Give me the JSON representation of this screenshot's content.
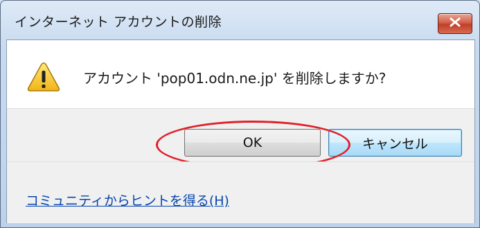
{
  "window": {
    "title": "インターネット アカウントの削除",
    "close_icon": "close-x-icon"
  },
  "dialog": {
    "icon": "warning-icon",
    "message": "アカウント 'pop01.odn.ne.jp' を削除しますか?"
  },
  "buttons": {
    "ok_label": "OK",
    "cancel_label": "キャンセル"
  },
  "footer": {
    "help_link": "コミュニティからヒントを得る(H)"
  },
  "colors": {
    "highlight_ring": "#e0202a",
    "link": "#0645ad",
    "focused_button_border": "#3c7fb1"
  }
}
